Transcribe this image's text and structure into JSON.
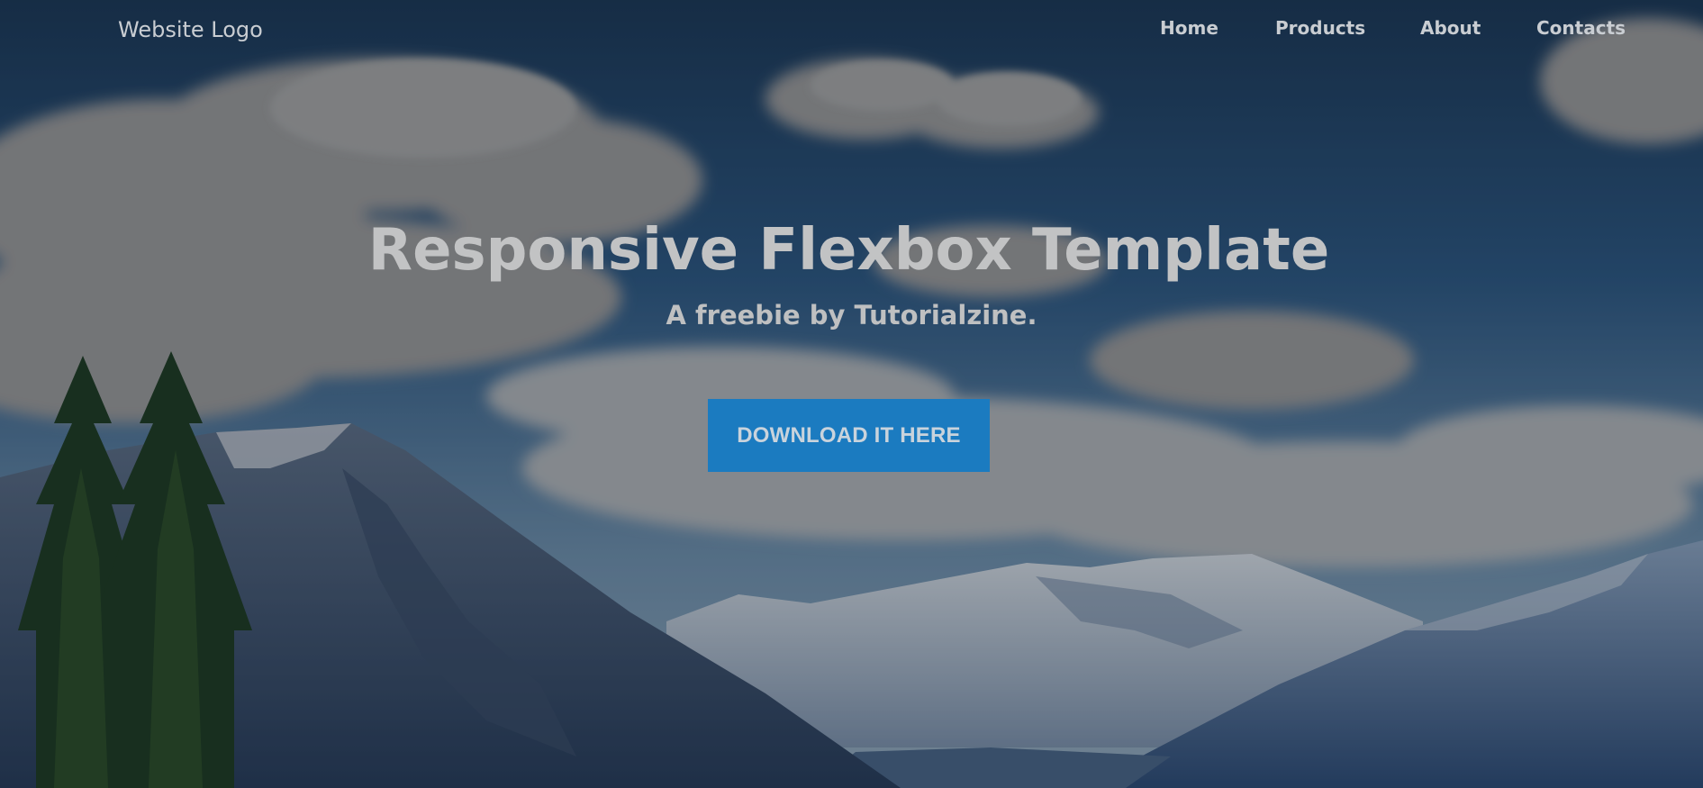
{
  "header": {
    "logo": "Website Logo",
    "nav": [
      "Home",
      "Products",
      "About",
      "Contacts"
    ]
  },
  "hero": {
    "title": "Responsive Flexbox Template",
    "subtitle": "A freebie by Tutorialzine.",
    "cta_label": "DOWNLOAD IT HERE",
    "background": "mountain-landscape-photo"
  },
  "colors": {
    "accent": "#1b7bc0",
    "text": "#c9cdd2"
  }
}
